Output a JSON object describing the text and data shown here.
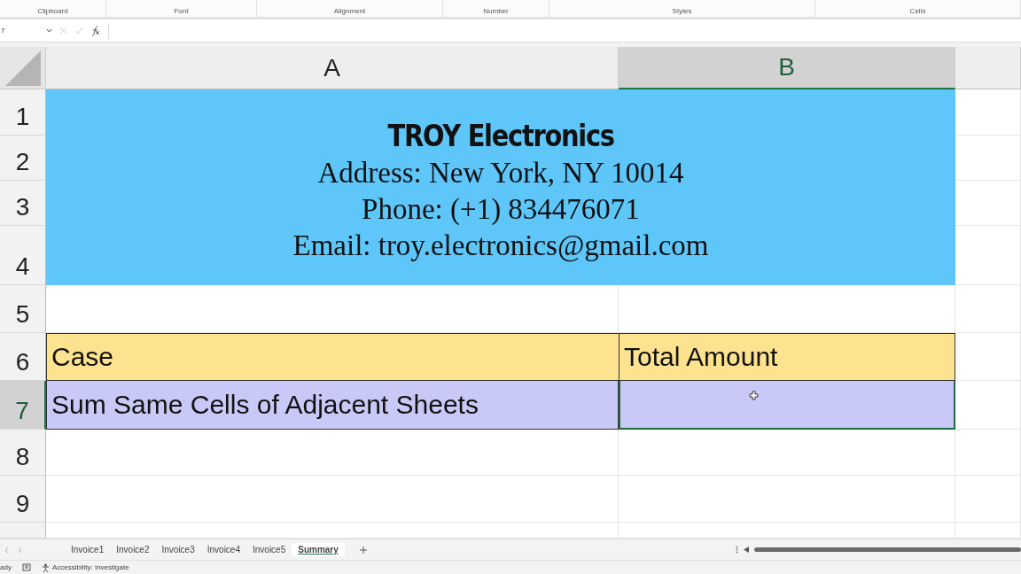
{
  "ribbon": {
    "groups": [
      "Clipboard",
      "Font",
      "Alignment",
      "Number",
      "Styles",
      "Cells"
    ]
  },
  "formula_bar": {
    "name_box": "7"
  },
  "columns": [
    {
      "label": "A",
      "selected": false
    },
    {
      "label": "B",
      "selected": true
    }
  ],
  "rows": [
    {
      "label": "1",
      "selected": false
    },
    {
      "label": "2",
      "selected": false
    },
    {
      "label": "3",
      "selected": false
    },
    {
      "label": "4",
      "selected": false
    },
    {
      "label": "5",
      "selected": false
    },
    {
      "label": "6",
      "selected": false
    },
    {
      "label": "7",
      "selected": true
    },
    {
      "label": "8",
      "selected": false
    },
    {
      "label": "9",
      "selected": false
    }
  ],
  "header_block": {
    "title": "TROY Electronics",
    "lines": [
      "Address: New York, NY 10014",
      "Phone: (+1) 834476071",
      "Email: troy.electronics@gmail.com"
    ]
  },
  "table": {
    "header": [
      "Case",
      "Total Amount"
    ],
    "rows": [
      {
        "case": "Sum Same Cells of Adjacent Sheets",
        "total_selected": true
      }
    ]
  },
  "sheet_tabs": [
    {
      "label": "Invoice1",
      "selected": false
    },
    {
      "label": "Invoice2",
      "selected": false
    },
    {
      "label": "Invoice3",
      "selected": false
    },
    {
      "label": "Invoice4",
      "selected": false
    },
    {
      "label": "Invoice5",
      "selected": false
    },
    {
      "label": "Summary",
      "selected": true
    }
  ],
  "status_bar": {
    "mode": "ady",
    "accessibility": "Accessibility: Investigate"
  }
}
